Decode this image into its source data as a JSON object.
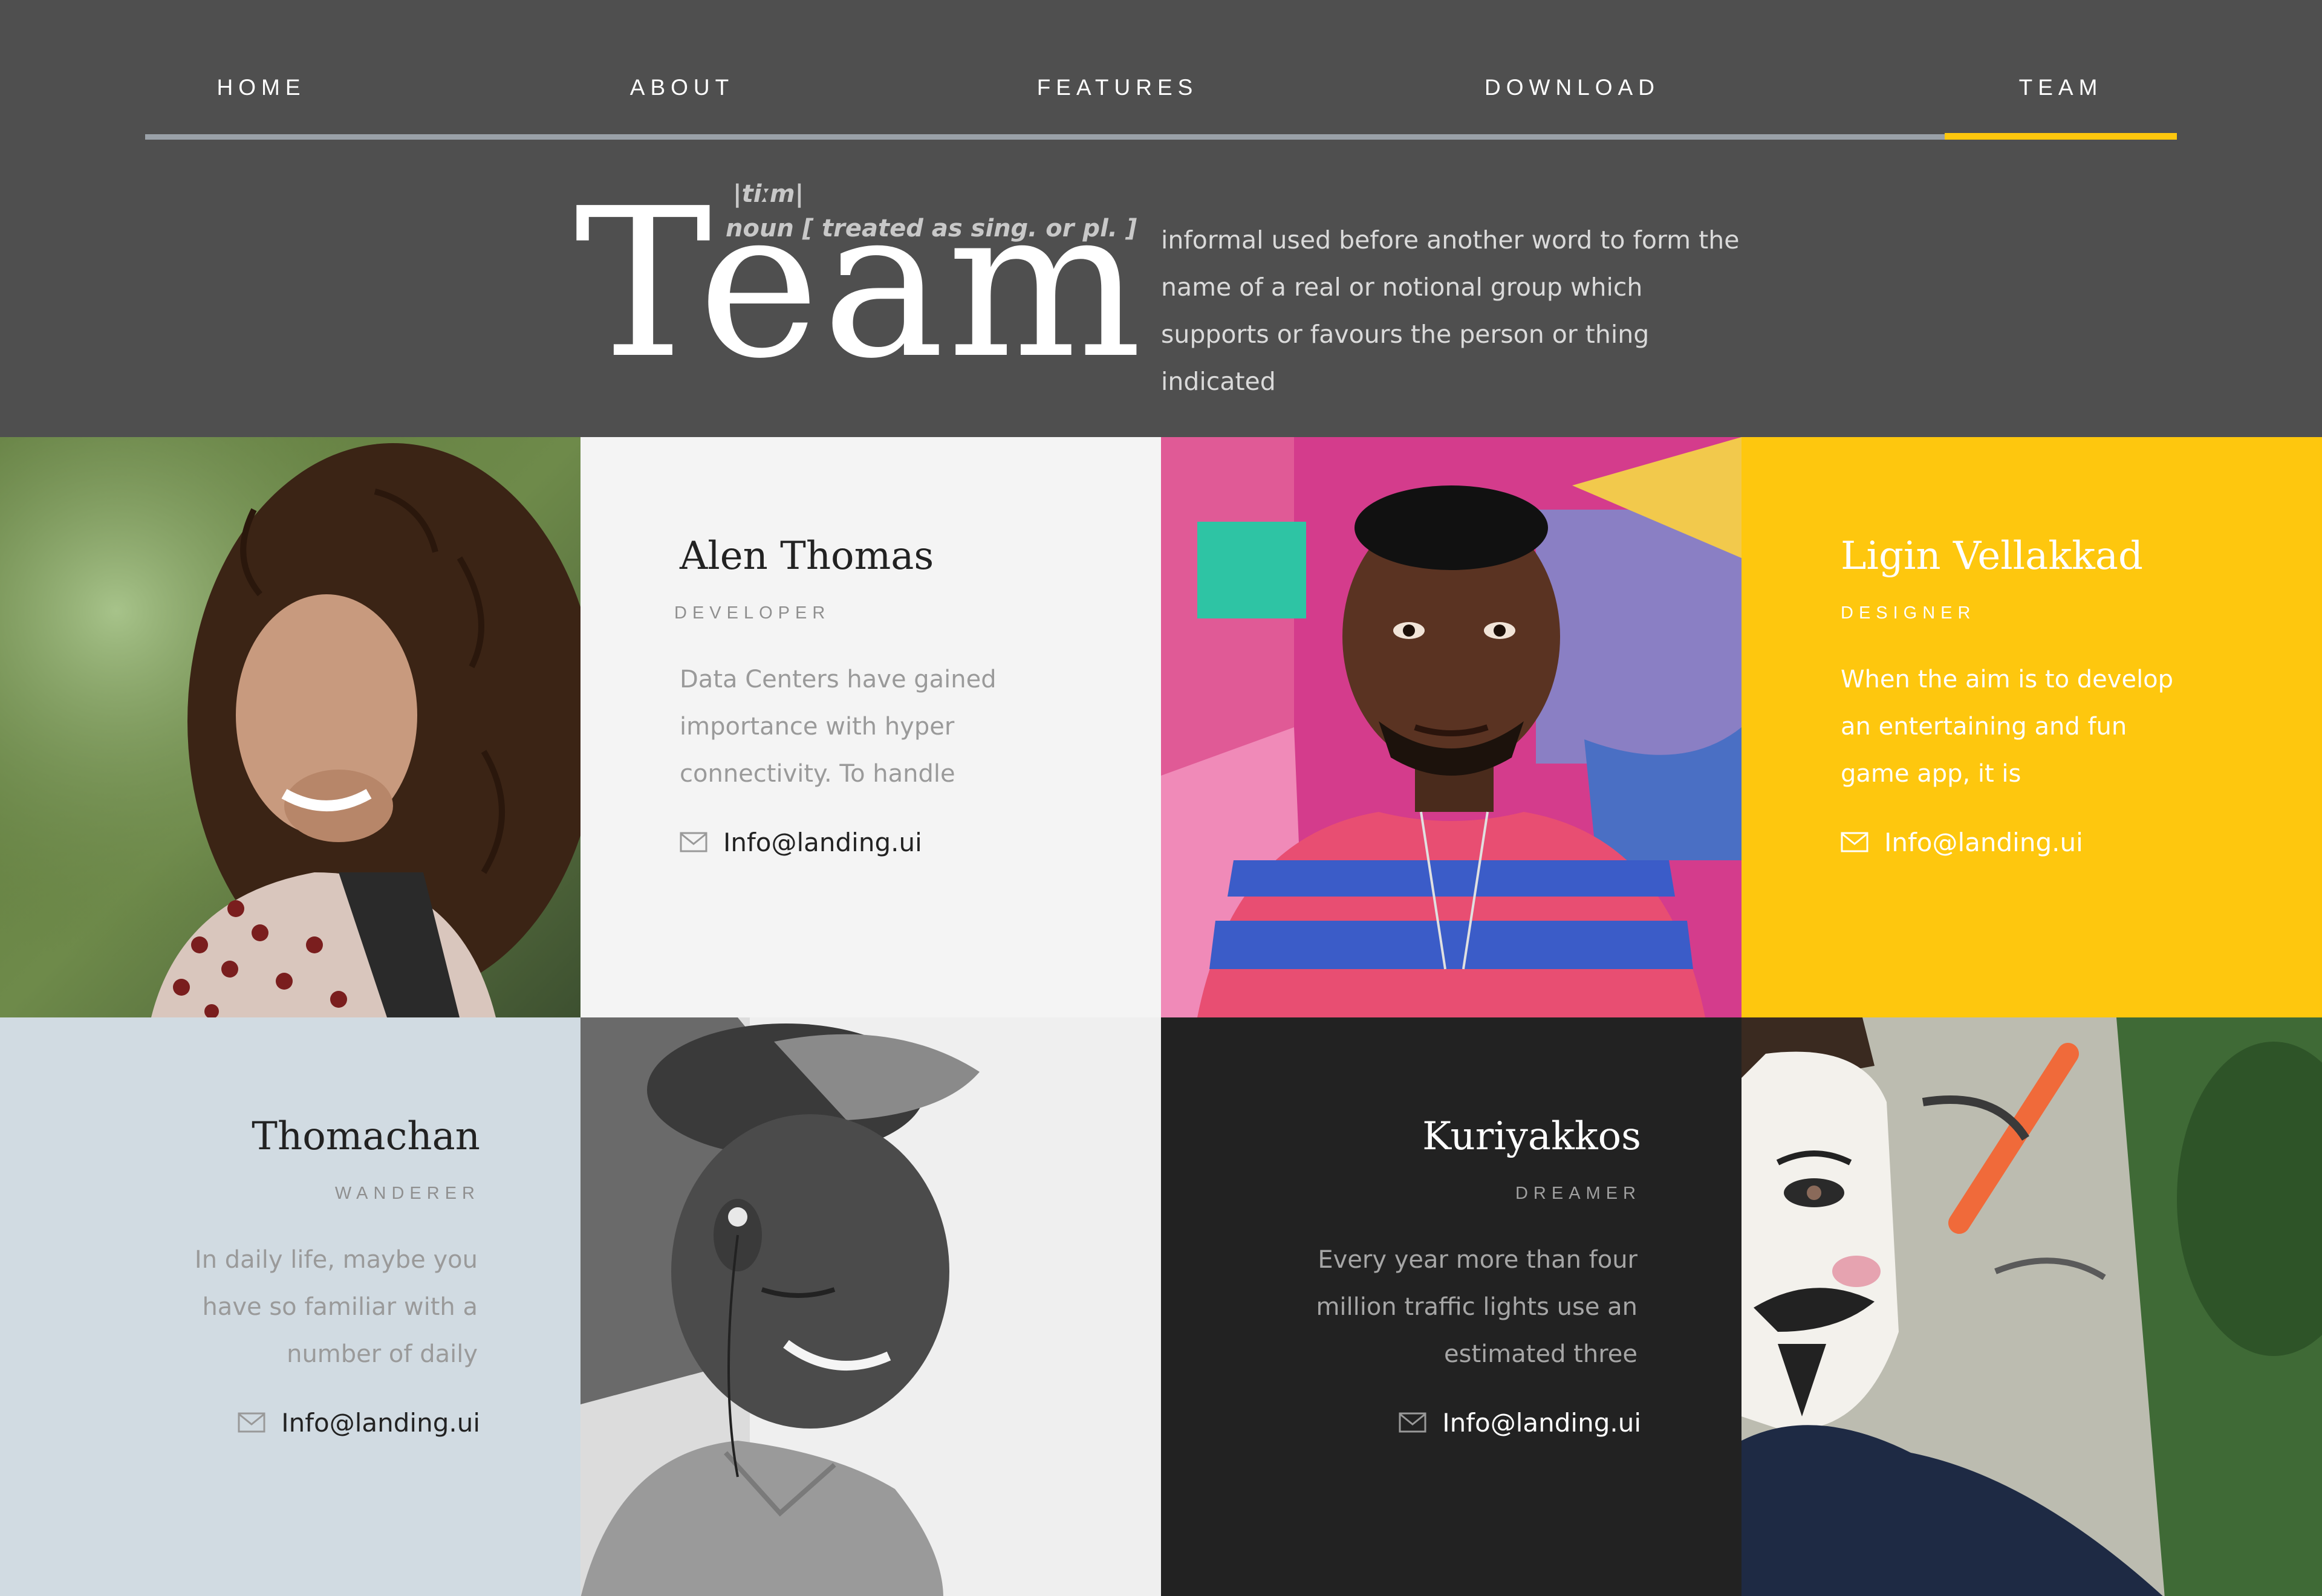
{
  "nav": {
    "items": [
      {
        "label": "HOME"
      },
      {
        "label": "ABOUT"
      },
      {
        "label": "FEATURES"
      },
      {
        "label": "DOWNLOAD"
      },
      {
        "label": "TEAM"
      }
    ],
    "active": "TEAM",
    "active_color": "#fec70e"
  },
  "hero": {
    "title": "Team",
    "phonetic": "|tiːm|",
    "part_of_speech": "noun [ treated as sing. or pl. ]",
    "definition": "informal used before another word to form the name of a real or notional group which supports or favours the person or thing indicated"
  },
  "members": [
    {
      "name": "Alen Thomas",
      "role": "DEVELOPER",
      "description": "Data Centers have gained importance with hyper connectivity. To handle",
      "email": "Info@landing.ui",
      "card_color": "#f4f4f4"
    },
    {
      "name": "Ligin Vellakkad",
      "role": "DESIGNER",
      "description": "When the aim is to develop an entertaining and fun game app, it is",
      "email": "Info@landing.ui",
      "card_color": "#fec70e"
    },
    {
      "name": "Thomachan",
      "role": "WANDERER",
      "description": "In daily life, maybe you have so familiar with a number of daily",
      "email": "Info@landing.ui",
      "card_color": "#d1dbe2"
    },
    {
      "name": "Kuriyakkos",
      "role": "DREAMER",
      "description": "Every year more than four million traffic lights use an estimated three",
      "email": "Info@landing.ui",
      "card_color": "#222222"
    }
  ]
}
